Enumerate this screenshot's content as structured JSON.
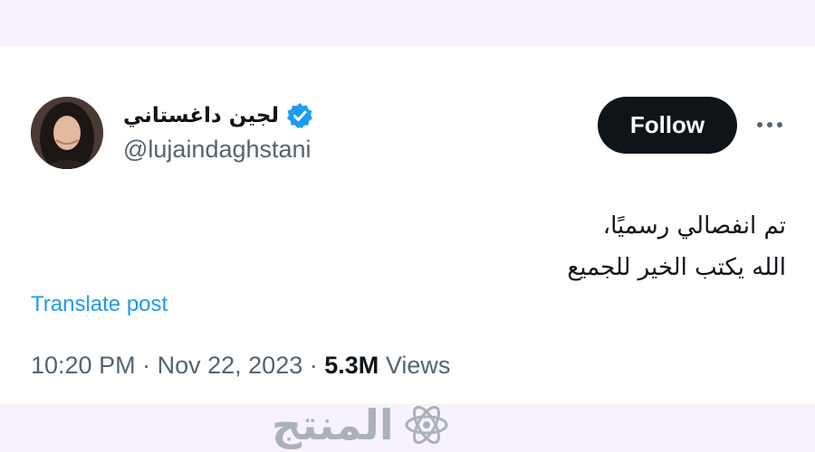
{
  "post": {
    "author": {
      "display_name": "لجين داغستاني",
      "handle": "@lujaindaghstani",
      "verified": true,
      "avatar_icon": "profile-photo"
    },
    "follow_label": "Follow",
    "more_icon": "ellipsis-icon",
    "text_lines": [
      "تم انفصالي رسميًا،",
      "الله يكتب الخير للجميع"
    ],
    "translate_label": "Translate post",
    "time": "10:20 PM",
    "date": "Nov 22, 2023",
    "separator": "·",
    "views_count": "5.3M",
    "views_label": "Views"
  },
  "watermark": {
    "text": "المنتج"
  },
  "colors": {
    "page_background": "#f7f2fb",
    "card_background": "#ffffff",
    "text_primary": "#0f1419",
    "text_secondary": "#536471",
    "link": "#1d9bf0",
    "verified_badge": "#1d9bf0",
    "follow_button": "#0f1419"
  }
}
